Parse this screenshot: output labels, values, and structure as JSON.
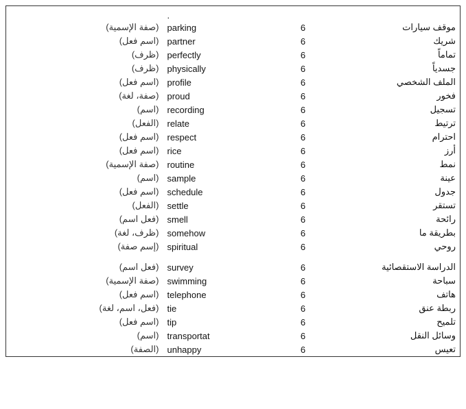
{
  "rows": [
    {
      "arabic_label": "(صفة الإسمية)",
      "english": "parking",
      "number": "6",
      "arabic_word": "موقف سيارات"
    },
    {
      "arabic_label": "(اسم فعل)",
      "english": "partner",
      "number": "6",
      "arabic_word": "شريك"
    },
    {
      "arabic_label": "(ظرف)",
      "english": "perfectly",
      "number": "6",
      "arabic_word": "تماماً"
    },
    {
      "arabic_label": "(ظرف)",
      "english": "physically",
      "number": "6",
      "arabic_word": "جسدياً"
    },
    {
      "arabic_label": "(اسم فعل)",
      "english": "profile",
      "number": "6",
      "arabic_word": "الملف الشخصي"
    },
    {
      "arabic_label": "(صفة، لغة)",
      "english": "proud",
      "number": "6",
      "arabic_word": "فخور"
    },
    {
      "arabic_label": "(اسم)",
      "english": "recording",
      "number": "6",
      "arabic_word": "تسجيل"
    },
    {
      "arabic_label": "(الفعل)",
      "english": "relate",
      "number": "6",
      "arabic_word": "ترتيط"
    },
    {
      "arabic_label": "(اسم فعل)",
      "english": "respect",
      "number": "6",
      "arabic_word": "احترام"
    },
    {
      "arabic_label": "(اسم فعل)",
      "english": "rice",
      "number": "6",
      "arabic_word": "أرز"
    },
    {
      "arabic_label": "(صفة الإسمية)",
      "english": "routine",
      "number": "6",
      "arabic_word": "نمط"
    },
    {
      "arabic_label": "(اسم)",
      "english": "sample",
      "number": "6",
      "arabic_word": "عينة"
    },
    {
      "arabic_label": "(اسم فعل)",
      "english": "schedule",
      "number": "6",
      "arabic_word": "جدول"
    },
    {
      "arabic_label": "(الفعل)",
      "english": "settle",
      "number": "6",
      "arabic_word": "تستقر"
    },
    {
      "arabic_label": "(فعل اسم)",
      "english": "smell",
      "number": "6",
      "arabic_word": "رائحة"
    },
    {
      "arabic_label": "(ظرف، لغة)",
      "english": "somehow",
      "number": "6",
      "arabic_word": "بطريقة ما"
    },
    {
      "arabic_label": "(إسم صفة)",
      "english": "spiritual",
      "number": "6",
      "arabic_word": "روحي"
    },
    {
      "arabic_label": "",
      "english": "",
      "number": "",
      "arabic_word": "",
      "spacer": true
    },
    {
      "arabic_label": "(فعل اسم)",
      "english": "survey",
      "number": "6",
      "arabic_word": "الدراسة الاستقصائية"
    },
    {
      "arabic_label": "(صفة الإسمية)",
      "english": "swimming",
      "number": "6",
      "arabic_word": "سباحة"
    },
    {
      "arabic_label": "(اسم فعل)",
      "english": "telephone",
      "number": "6",
      "arabic_word": "هاتف"
    },
    {
      "arabic_label": "(فعل، اسم، لغة)",
      "english": "tie",
      "number": "6",
      "arabic_word": "ربطة عنق"
    },
    {
      "arabic_label": "(اسم فعل)",
      "english": "tip",
      "number": "6",
      "arabic_word": "تلميح"
    },
    {
      "arabic_label": "(اسم)",
      "english": "transportat",
      "number": "6",
      "arabic_word": "وسائل النقل"
    },
    {
      "arabic_label": "(الصفة)",
      "english": "unhappy",
      "number": "6",
      "arabic_word": "تعيس"
    }
  ],
  "dot": "."
}
